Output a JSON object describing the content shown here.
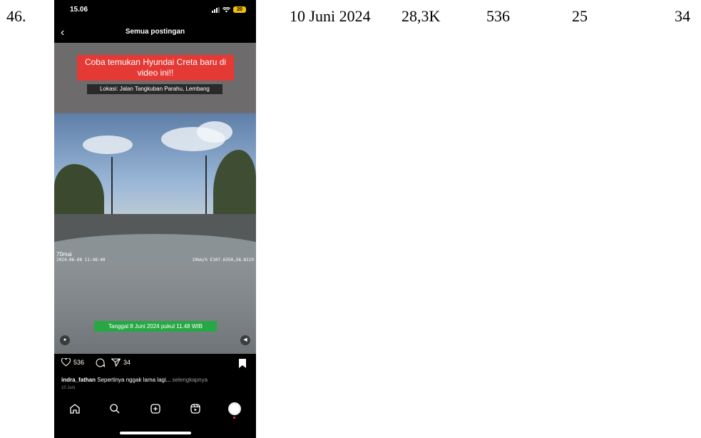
{
  "row": {
    "number": "46.",
    "date": "10 Juni 2024",
    "views": "28,3K",
    "likes": "536",
    "comments": "25",
    "shares": "34"
  },
  "phone": {
    "status": {
      "time": "15.06",
      "battery": "20"
    },
    "header": {
      "title": "Semua postingan",
      "back_icon": "chevron-left-icon"
    },
    "video": {
      "headline": "Coba temukan Hyundai Creta baru di video ini!!",
      "location": "Lokasi: Jalan Tangkuban Parahu, Lembang",
      "cam_brand": "70mai",
      "cam_timestamp": "2024-06-08 11:48:40",
      "cam_speed": "19km/h E107.6350,S6.8119",
      "date_caption": "Tanggal 8 Juni 2024 pukul 11.48 WIB"
    },
    "actions": {
      "likes": "536",
      "shares": "34"
    },
    "caption": {
      "username": "indra_fathan",
      "text": "Sepertinya nggak lama lagi...",
      "more": "selengkapnya",
      "date": "10 Juni"
    },
    "colors": {
      "headline_bg": "#e53935",
      "date_caption_bg": "#27a844",
      "battery": "#f2c200"
    }
  }
}
